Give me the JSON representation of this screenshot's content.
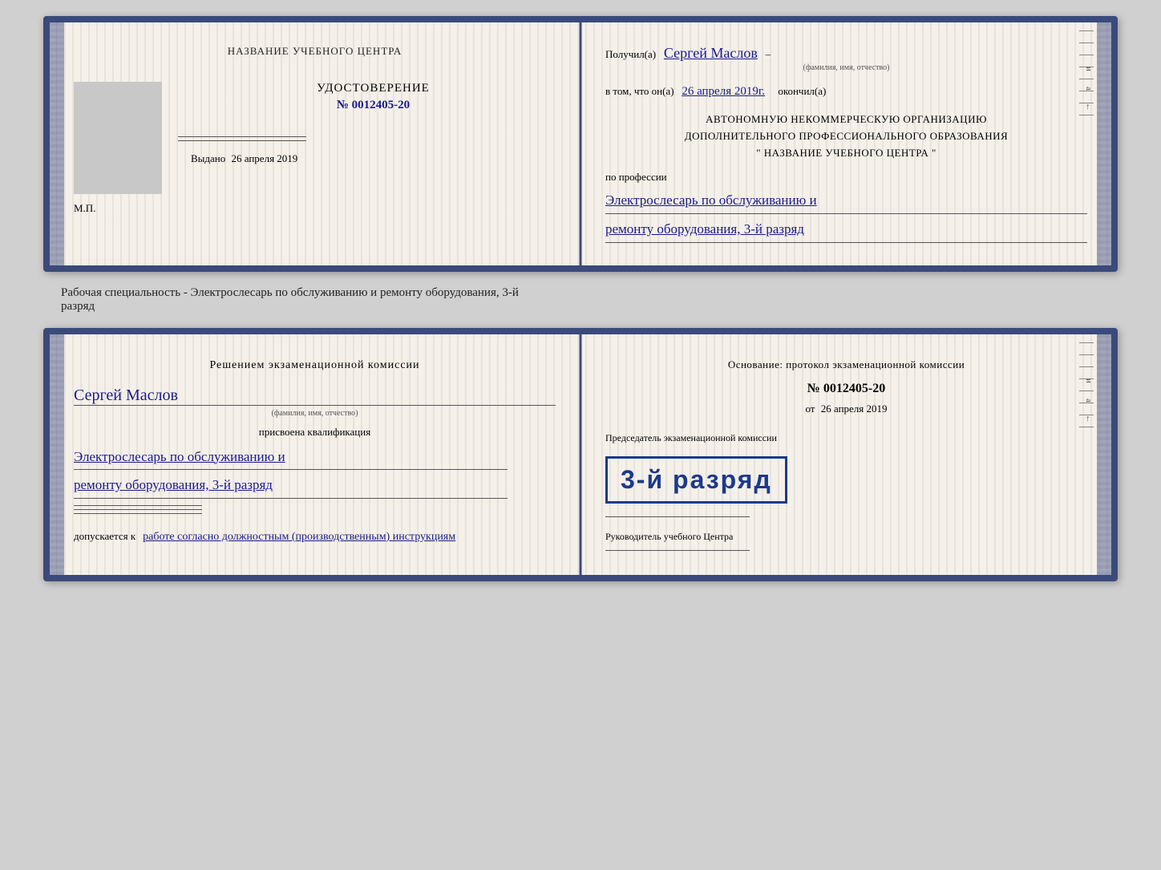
{
  "cert1": {
    "left": {
      "title": "НАЗВАНИЕ УЧЕБНОГО ЦЕНТРА",
      "doc_type": "УДОСТОВЕРЕНИЕ",
      "doc_number": "№ 0012405-20",
      "issued_label": "Выдано",
      "issued_date": "26 апреля 2019",
      "mp": "М.П."
    },
    "right": {
      "received_label": "Получил(а)",
      "recipient_name": "Сергей Маслов",
      "fio_label": "(фамилия, имя, отчество)",
      "in_that_label": "в том, что он(а)",
      "date_completed": "26 апреля 2019г.",
      "finished_label": "окончил(а)",
      "org_line1": "АВТОНОМНУЮ НЕКОММЕРЧЕСКУЮ ОРГАНИЗАЦИЮ",
      "org_line2": "ДОПОЛНИТЕЛЬНОГО ПРОФЕССИОНАЛЬНОГО ОБРАЗОВАНИЯ",
      "org_line3": "\" НАЗВАНИЕ УЧЕБНОГО ЦЕНТРА \"",
      "profession_label": "по профессии",
      "profession_text": "Электрослесарь по обслуживанию и",
      "profession_text2": "ремонту оборудования, 3-й разряд"
    }
  },
  "specialty_label": "Рабочая специальность - Электрослесарь по обслуживанию и ремонту оборудования, 3-й",
  "specialty_label2": "разряд",
  "cert2": {
    "left": {
      "commission_title_line1": "Решением экзаменационной комиссии",
      "person_name": "Сергей Маслов",
      "fio_label": "(фамилия, имя, отчество)",
      "qualification_label": "присвоена квалификация",
      "qualification_text": "Электрослесарь по обслуживанию и",
      "qualification_text2": "ремонту оборудования, 3-й разряд",
      "допуск_prefix": "допускается к",
      "допуск_text": "работе согласно должностным (производственным) инструкциям"
    },
    "right": {
      "osnov_label": "Основание: протокол экзаменационной комиссии",
      "protocol_number": "№  0012405-20",
      "date_prefix": "от",
      "date": "26 апреля 2019",
      "chairman_label": "Председатель экзаменационной комиссии",
      "stamp_main": "3-й разряд",
      "руков_label": "Руководитель учебного Центра"
    }
  }
}
